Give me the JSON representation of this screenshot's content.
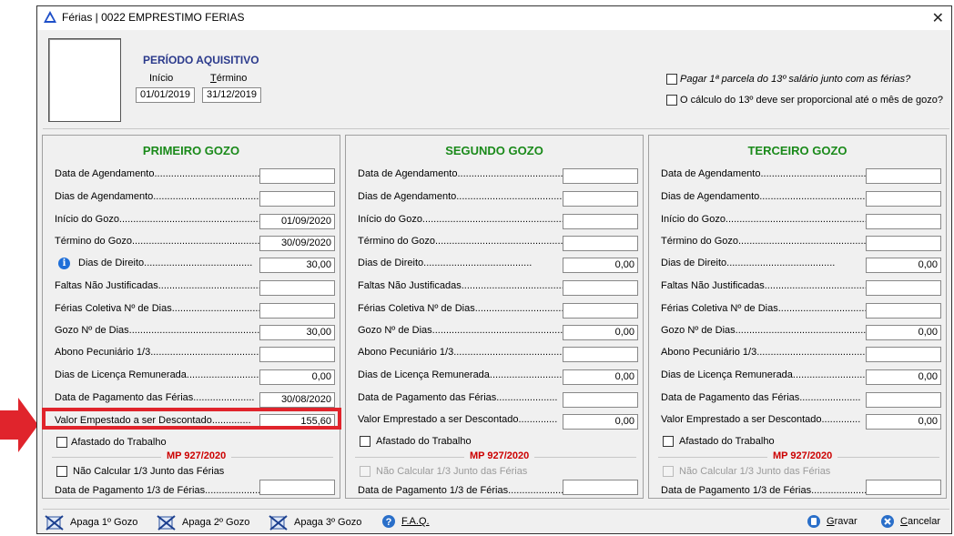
{
  "window": {
    "title": "Férias | 0022 EMPRESTIMO FERIAS",
    "close": "✕"
  },
  "periodo": {
    "title": "PERÍODO AQUISITIVO",
    "inicio_label": "Início",
    "termino_label": "Término",
    "inicio_value": "01/01/2019",
    "termino_value": "31/12/2019"
  },
  "options": {
    "pagar_13": "Pagar 1ª parcela do 13º salário junto com as férias?",
    "calculo_13": "O cálculo do 13º deve ser proporcional até o mês de gozo?"
  },
  "labels": {
    "data_agendamento": "Data de Agendamento.......................................",
    "dias_agendamento": "Dias de Agendamento.......................................",
    "inicio_gozo": "Início do Gozo.......................................................",
    "termino_gozo": "Término do Gozo.....................................................",
    "dias_direito": "Dias de Direito.......................................",
    "dias_direito_p1": "Dias de Direito.......................................",
    "faltas": "Faltas Não Justificadas.........................................",
    "ferias_coletiva": "Férias Coletiva Nº de Dias......................................",
    "gozo_dias": "Gozo Nº de Dias........................................................",
    "abono": "Abono Pecuniário 1/3.................................................",
    "licenca": "Dias de Licença Remunerada...........................",
    "pagamento": "Data de Pagamento das Férias......................",
    "valor_emprestado": "Valor Empestado a ser Descontado..............",
    "valor_emprestado_23": "Valor Emprestado a ser Descontado..............",
    "afastado": "Afastado do Trabalho",
    "mp": "MP 927/2020",
    "nao_calcular": "Não Calcular 1/3 Junto das Férias",
    "pagamento_13": "Data de Pagamento 1/3 de Férias........................"
  },
  "panels": [
    {
      "title": "PRIMEIRO GOZO",
      "values": {
        "data_agendamento": "",
        "dias_agendamento": "",
        "inicio_gozo": "01/09/2020",
        "termino_gozo": "30/09/2020",
        "dias_direito": "30,00",
        "faltas": "",
        "ferias_coletiva": "",
        "gozo_dias": "30,00",
        "abono": "",
        "licenca": "0,00",
        "pagamento": "30/08/2020",
        "valor_emprestado": "155,60",
        "pagamento_13": ""
      }
    },
    {
      "title": "SEGUNDO GOZO",
      "values": {
        "data_agendamento": "",
        "dias_agendamento": "",
        "inicio_gozo": "",
        "termino_gozo": "",
        "dias_direito": "0,00",
        "faltas": "",
        "ferias_coletiva": "",
        "gozo_dias": "0,00",
        "abono": "",
        "licenca": "0,00",
        "pagamento": "",
        "valor_emprestado": "0,00",
        "pagamento_13": ""
      }
    },
    {
      "title": "TERCEIRO GOZO",
      "values": {
        "data_agendamento": "",
        "dias_agendamento": "",
        "inicio_gozo": "",
        "termino_gozo": "",
        "dias_direito": "0,00",
        "faltas": "",
        "ferias_coletiva": "",
        "gozo_dias": "0,00",
        "abono": "",
        "licenca": "0,00",
        "pagamento": "",
        "valor_emprestado": "0,00",
        "pagamento_13": ""
      }
    }
  ],
  "footer": {
    "apaga1": "Apaga 1º Gozo",
    "apaga2": "Apaga 2º Gozo",
    "apaga3": "Apaga 3º Gozo",
    "faq": "F.A.Q.",
    "gravar": "Gravar",
    "cancelar": "Cancelar"
  },
  "colors": {
    "accent_green": "#1a8a1a",
    "title_blue": "#2b3a8c",
    "mp_red": "#cc0000",
    "highlight_red": "#e0242c"
  }
}
